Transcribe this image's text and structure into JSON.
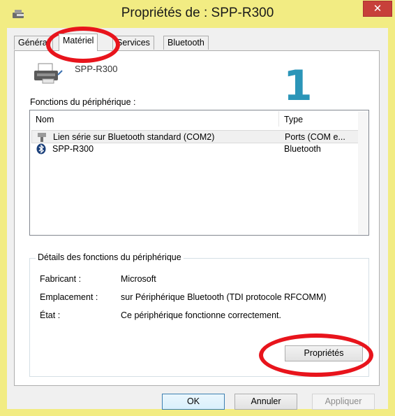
{
  "window": {
    "title": "Propriétés de : SPP-R300",
    "close_glyph": "✕"
  },
  "tabs": [
    {
      "label": "Général",
      "active": false
    },
    {
      "label": "Matériel",
      "active": true
    },
    {
      "label": "Services",
      "active": false
    },
    {
      "label": "Bluetooth",
      "active": false
    }
  ],
  "device": {
    "name": "SPP-R300"
  },
  "annotation": {
    "step_number": "1",
    "color": "#e8141c",
    "number_color": "#2b95b8"
  },
  "functions": {
    "label": "Fonctions du périphérique :",
    "columns": {
      "name": "Nom",
      "type": "Type"
    },
    "rows": [
      {
        "name": "Lien série sur Bluetooth standard (COM2)",
        "type": "Ports (COM e...",
        "icon": "serial-port-icon",
        "selected": true
      },
      {
        "name": "SPP-R300",
        "type": "Bluetooth",
        "icon": "bluetooth-icon",
        "selected": false
      }
    ]
  },
  "details": {
    "legend": "Détails des fonctions du périphérique",
    "manufacturer": {
      "label": "Fabricant :",
      "value": "Microsoft"
    },
    "location": {
      "label": "Emplacement :",
      "value": "sur Périphérique Bluetooth (TDI protocole RFCOMM)"
    },
    "status": {
      "label": "État :",
      "value": "Ce périphérique fonctionne correctement."
    },
    "properties_button": "Propriétés"
  },
  "buttons": {
    "ok": "OK",
    "cancel": "Annuler",
    "apply": "Appliquer"
  },
  "colors": {
    "window_frame": "#f2ec83",
    "close_button": "#c7403a",
    "accent": "#3c7fb1"
  }
}
